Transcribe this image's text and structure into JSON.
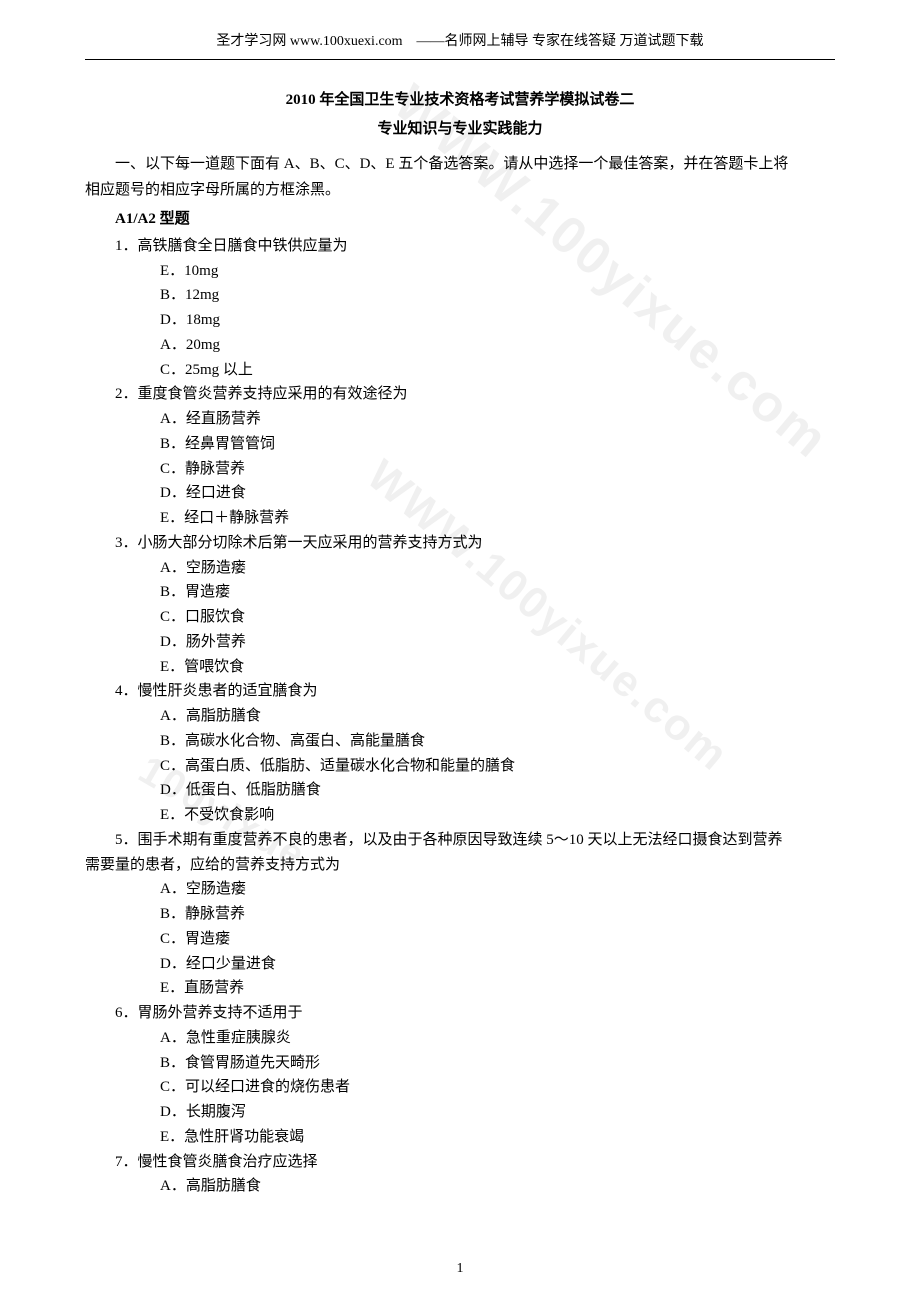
{
  "header": "圣才学习网 www.100xuexi.com　——名师网上辅导  专家在线答疑  万道试题下载",
  "title": "2010 年全国卫生专业技术资格考试营养学模拟试卷二",
  "subtitle": "专业知识与专业实践能力",
  "intro_a": "一、以下每一道题下面有 A、B、C、D、E 五个备选答案。请从中选择一个最佳答案，并在答题卡上将",
  "intro_b": "相应题号的相应字母所属的方框涂黑。",
  "qtype": "A1/A2 型题",
  "questions": [
    {
      "stem": "1．高铁膳食全日膳食中铁供应量为",
      "opts": [
        "E．10mg",
        "B．12mg",
        "D．18mg",
        "A．20mg",
        "C．25mg 以上"
      ]
    },
    {
      "stem": "2．重度食管炎营养支持应采用的有效途径为",
      "opts": [
        "A．经直肠营养",
        "B．经鼻胃管管饲",
        "C．静脉营养",
        "D．经口进食",
        "E．经口＋静脉营养"
      ]
    },
    {
      "stem": "3．小肠大部分切除术后第一天应采用的营养支持方式为",
      "opts": [
        "A．空肠造瘘",
        "B．胃造瘘",
        "C．口服饮食",
        "D．肠外营养",
        "E．管喂饮食"
      ]
    },
    {
      "stem": "4．慢性肝炎患者的适宜膳食为",
      "opts": [
        "A．高脂肪膳食",
        "B．高碳水化合物、高蛋白、高能量膳食",
        "C．高蛋白质、低脂肪、适量碳水化合物和能量的膳食",
        "D．低蛋白、低脂肪膳食",
        "E．不受饮食影响"
      ]
    },
    {
      "stem": "5．围手术期有重度营养不良的患者，以及由于各种原因导致连续 5～10 天以上无法经口摄食达到营养",
      "stem2": "需要量的患者，应给的营养支持方式为",
      "opts": [
        "A．空肠造瘘",
        "B．静脉营养",
        "C．胃造瘘",
        "D．经口少量进食",
        "E．直肠营养"
      ]
    },
    {
      "stem": "6．胃肠外营养支持不适用于",
      "opts": [
        "A．急性重症胰腺炎",
        "B．食管胃肠道先天畸形",
        "C．可以经口进食的烧伤患者",
        "D．长期腹泻",
        "E．急性肝肾功能衰竭"
      ]
    },
    {
      "stem": "7．慢性食管炎膳食治疗应选择",
      "opts": [
        "A．高脂肪膳食"
      ]
    }
  ],
  "page": "1",
  "wm_main": "WWW.100yixue.com",
  "wm_sub": "100yixue"
}
